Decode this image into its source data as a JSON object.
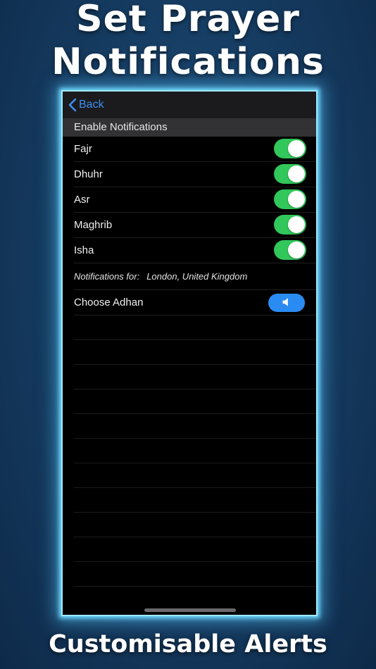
{
  "promo": {
    "headline_line1": "Set Prayer",
    "headline_line2": "Notifications",
    "footer": "Customisable Alerts"
  },
  "navbar": {
    "back_label": "Back",
    "back_icon": "chevron-left-icon"
  },
  "section": {
    "header": "Enable Notifications"
  },
  "prayers": [
    {
      "label": "Fajr",
      "enabled": true
    },
    {
      "label": "Dhuhr",
      "enabled": true
    },
    {
      "label": "Asr",
      "enabled": true
    },
    {
      "label": "Maghrib",
      "enabled": true
    },
    {
      "label": "Isha",
      "enabled": true
    }
  ],
  "location": {
    "prefix": "Notifications for:",
    "value": "London, United Kingdom"
  },
  "adhan": {
    "label": "Choose Adhan",
    "button_icon": "speaker-icon"
  },
  "colors": {
    "accent_blue": "#2a8bf2",
    "toggle_on": "#31c75a",
    "glow": "#6fd8ff"
  }
}
